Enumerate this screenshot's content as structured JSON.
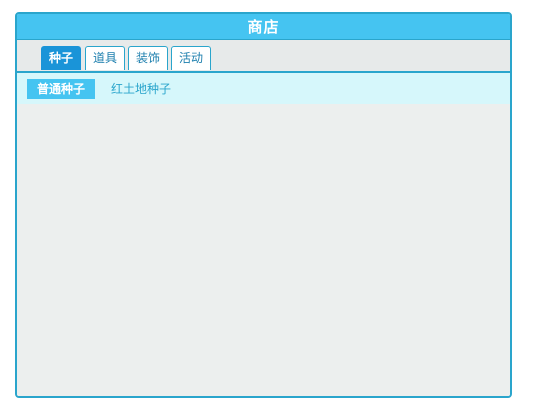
{
  "shop": {
    "title": "商店",
    "tabs": [
      {
        "label": "种子",
        "active": true
      },
      {
        "label": "道具",
        "active": false
      },
      {
        "label": "装饰",
        "active": false
      },
      {
        "label": "活动",
        "active": false
      }
    ],
    "category": "普通种子",
    "items": [
      "红土地种子"
    ]
  },
  "colors": {
    "accent": "#45c4f1",
    "border": "#2aa5cc",
    "active_tab": "#1a94d8",
    "sub_bar": "#d6f7fb",
    "panel_bg": "#ecefee"
  }
}
